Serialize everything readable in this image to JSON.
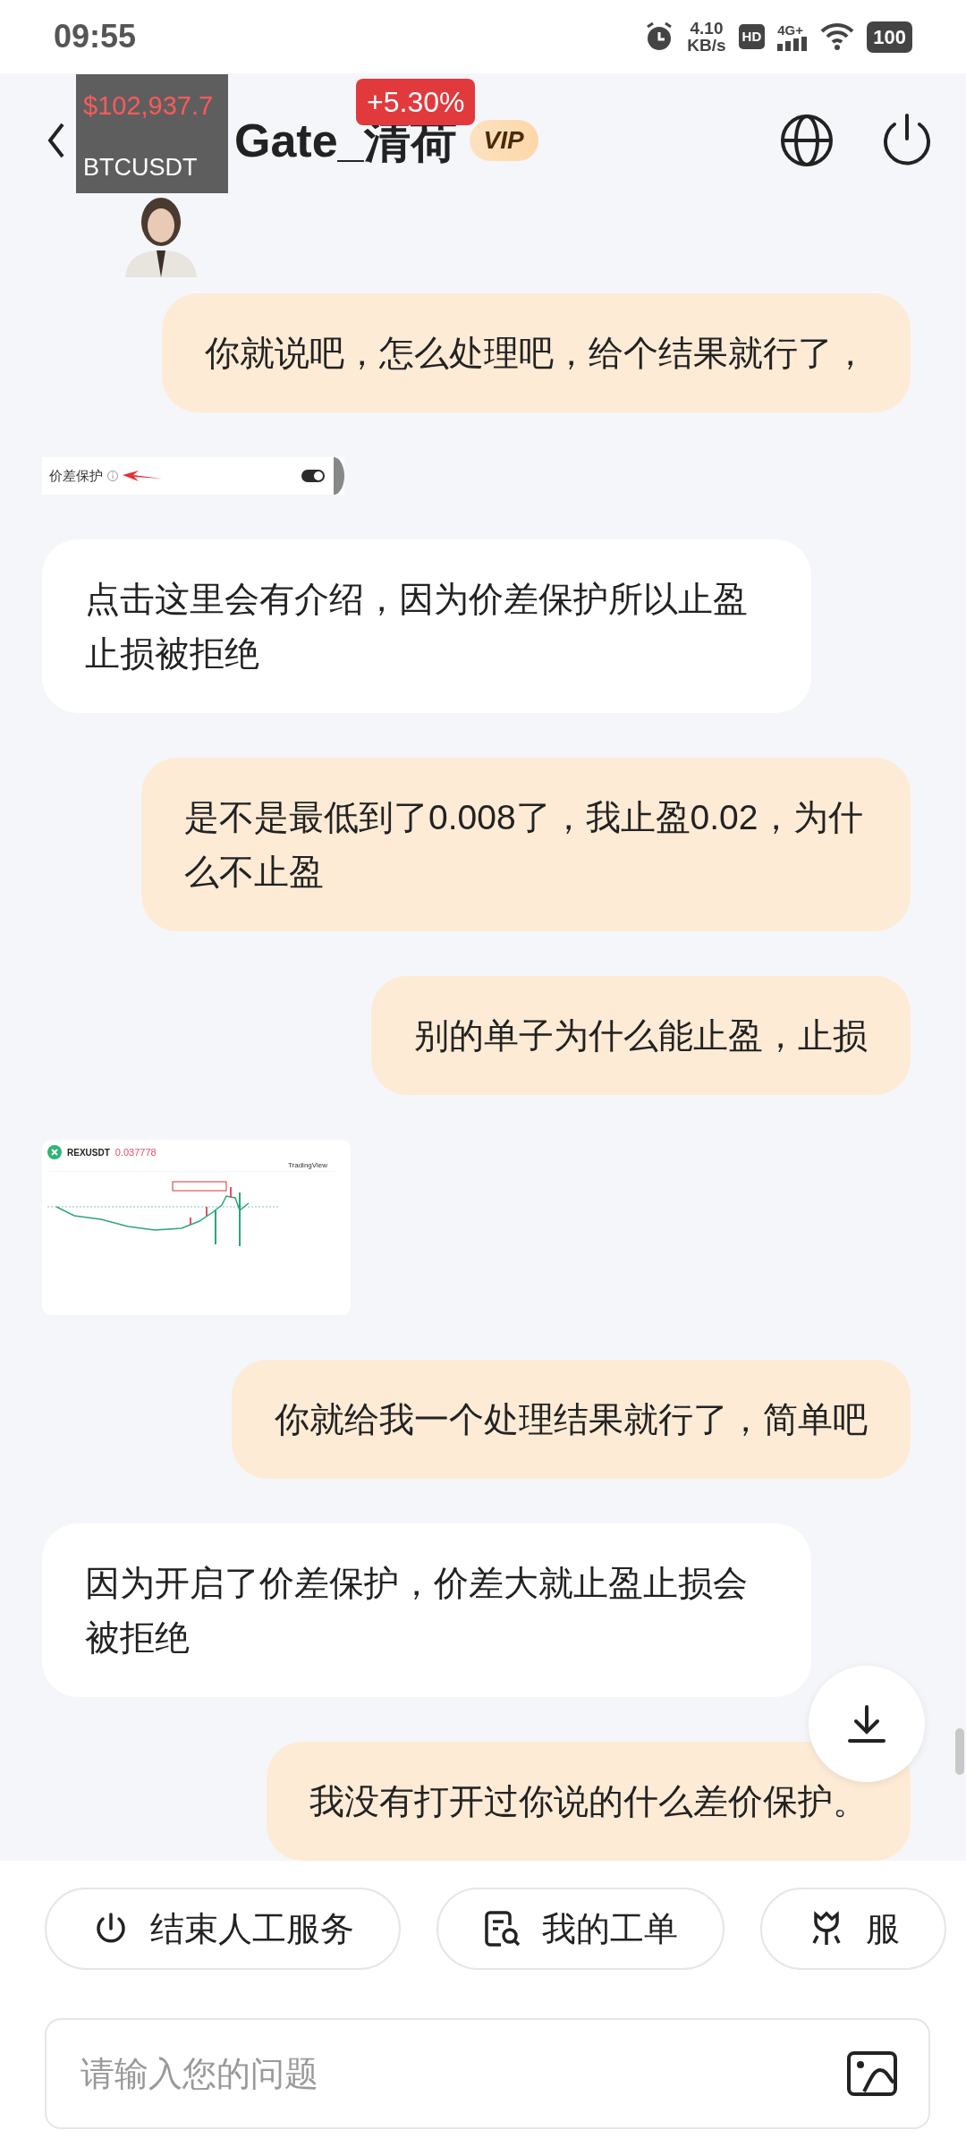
{
  "status_bar": {
    "time": "09:55",
    "net_speed": "4.10",
    "net_unit": "KB/s",
    "hd": "HD",
    "network": "4G+",
    "battery": "100"
  },
  "header": {
    "title": "Gate_清荷",
    "badge": "VIP"
  },
  "ticker_overlay": {
    "price": "$102,937.7",
    "symbol": "BTCUSDT",
    "change": "+5.30%"
  },
  "messages": [
    {
      "kind": "outgoing",
      "text": "你就说吧，怎么处理吧，给个结果就行了，"
    },
    {
      "kind": "setting_screenshot",
      "label": "价差保护",
      "on": true
    },
    {
      "kind": "incoming",
      "text": "点击这里会有介绍，因为价差保护所以止盈止损被拒绝"
    },
    {
      "kind": "outgoing",
      "text": "是不是最低到了0.008了，我止盈0.02，为什么不止盈"
    },
    {
      "kind": "outgoing",
      "text": "别的单子为什么能止盈，止损"
    },
    {
      "kind": "chart_screenshot",
      "symbol": "REXUSDT",
      "price": "0.037778",
      "chart_label": "TradingView"
    },
    {
      "kind": "outgoing",
      "text": "你就给我一个处理结果就行了，简单吧"
    },
    {
      "kind": "incoming",
      "text": "因为开启了价差保护，价差大就止盈止损会被拒绝"
    },
    {
      "kind": "outgoing",
      "text": "我没有打开过你说的什么差价保护。"
    }
  ],
  "quick_actions": [
    {
      "label": "结束人工服务"
    },
    {
      "label": "我的工单"
    },
    {
      "label": "服"
    }
  ],
  "input": {
    "placeholder": "请输入您的问题"
  }
}
